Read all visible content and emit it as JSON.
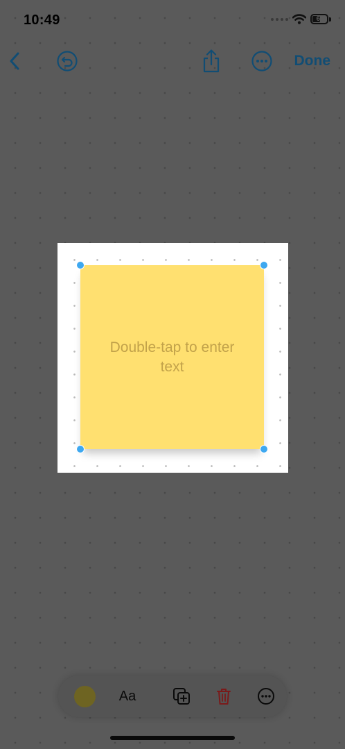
{
  "status_bar": {
    "time": "10:49",
    "battery_level": "61",
    "icons": [
      "cellular-signal-icon",
      "wifi-icon",
      "battery-icon"
    ]
  },
  "toolbar": {
    "back_icon": "chevron-left-icon",
    "undo_icon": "undo-icon",
    "share_icon": "share-icon",
    "more_icon": "ellipsis-circle-icon",
    "done_label": "Done"
  },
  "sticky_note": {
    "placeholder": "Double-tap to enter text",
    "color": "#ffe070"
  },
  "bottom_toolbar": {
    "color_icon": "color-swatch-icon",
    "text_style_label": "Aa",
    "duplicate_icon": "duplicate-icon",
    "delete_icon": "trash-icon",
    "more_icon": "ellipsis-circle-icon"
  },
  "colors": {
    "accent": "#114d74",
    "delete": "#7a1a1a",
    "selection_handle": "#3ea8f0",
    "dim_overlay": "#5a5a5a"
  }
}
